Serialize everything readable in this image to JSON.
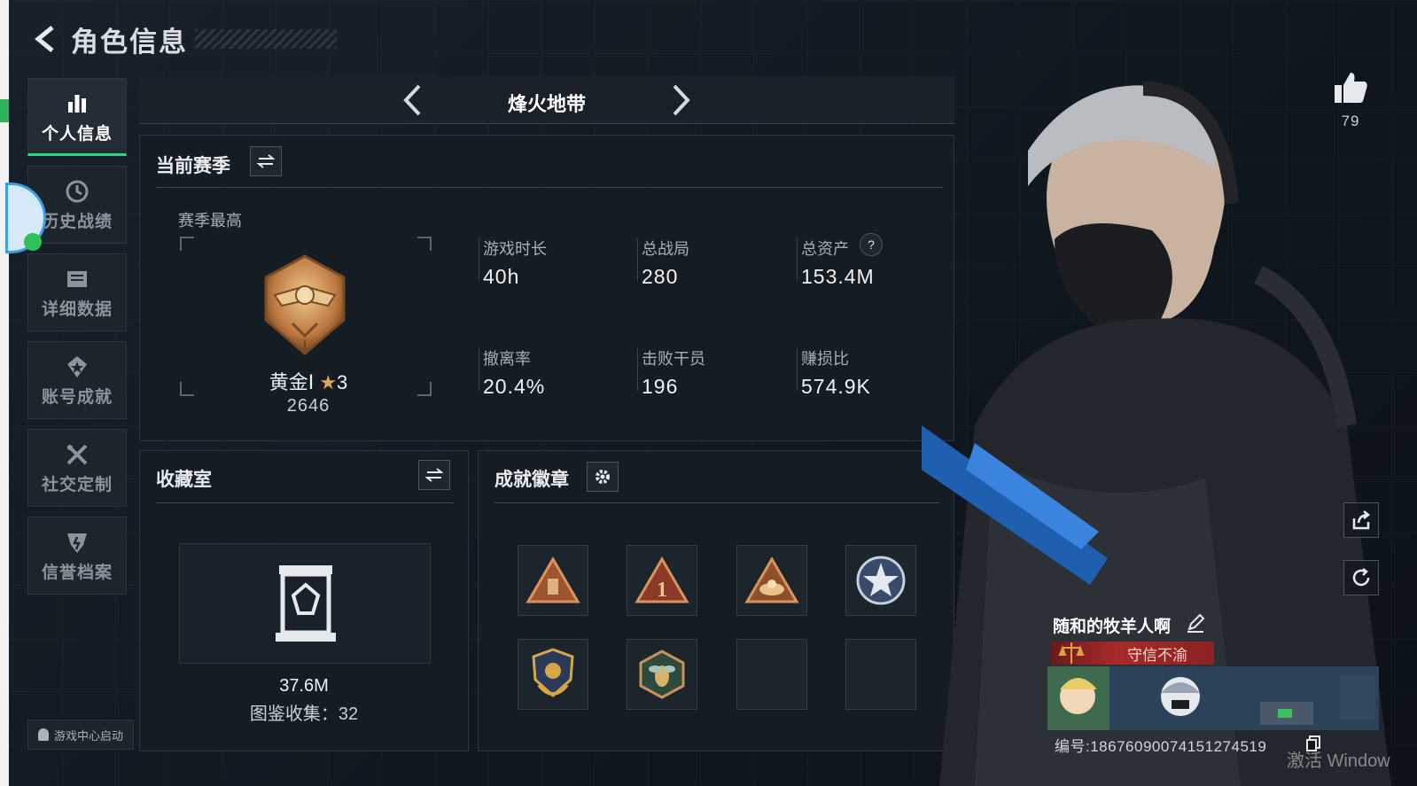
{
  "header": {
    "title": "角色信息"
  },
  "nav": {
    "items": [
      {
        "label": "个人信息",
        "icon": "bar-chart-icon",
        "active": true
      },
      {
        "label": "历史战绩",
        "icon": "history-clock-icon",
        "active": false
      },
      {
        "label": "详细数据",
        "icon": "folder-data-icon",
        "active": false
      },
      {
        "label": "账号成就",
        "icon": "achievement-star-icon",
        "active": false
      },
      {
        "label": "社交定制",
        "icon": "tools-icon",
        "active": false
      },
      {
        "label": "信誉档案",
        "icon": "credit-shield-icon",
        "active": false
      }
    ],
    "launch_label": "游戏中心启动"
  },
  "mode": {
    "title": "烽火地带"
  },
  "season": {
    "title": "当前赛季",
    "best_label": "赛季最高",
    "rank_name": "黄金Ⅰ",
    "rank_stars": "3",
    "rank_score": "2646",
    "stats": [
      {
        "label": "游戏时长",
        "value": "40h"
      },
      {
        "label": "总战局",
        "value": "280"
      },
      {
        "label": "总资产",
        "value": "153.4M"
      },
      {
        "label": "撤离率",
        "value": "20.4%"
      },
      {
        "label": "击败干员",
        "value": "196"
      },
      {
        "label": "赚损比",
        "value": "574.9K"
      }
    ]
  },
  "collection": {
    "title": "收藏室",
    "value": "37.6M",
    "count_text": "图鉴收集：32"
  },
  "badges": {
    "title": "成就徽章",
    "slots": [
      {
        "icon": "bronze-pyramid-badge-icon",
        "filled": true
      },
      {
        "icon": "bronze-number-one-badge-icon",
        "filled": true
      },
      {
        "icon": "bronze-nest-badge-icon",
        "filled": true
      },
      {
        "icon": "silver-star-skull-badge-icon",
        "filled": true
      },
      {
        "icon": "gold-shield-laurel-badge-icon",
        "filled": true
      },
      {
        "icon": "bee-hexagon-badge-icon",
        "filled": true
      },
      {
        "icon": "",
        "filled": false
      },
      {
        "icon": "",
        "filled": false
      }
    ]
  },
  "profile": {
    "likes": "79",
    "player_name": "随和的牧羊人啊",
    "honor_title": "守信不渝",
    "player_id": "编号:18676090074151274519",
    "watermark": "激活 Window"
  },
  "colors": {
    "accent_green": "#2fd48a",
    "honor_red": "#a82a2a",
    "bronze": "#b5673a"
  }
}
